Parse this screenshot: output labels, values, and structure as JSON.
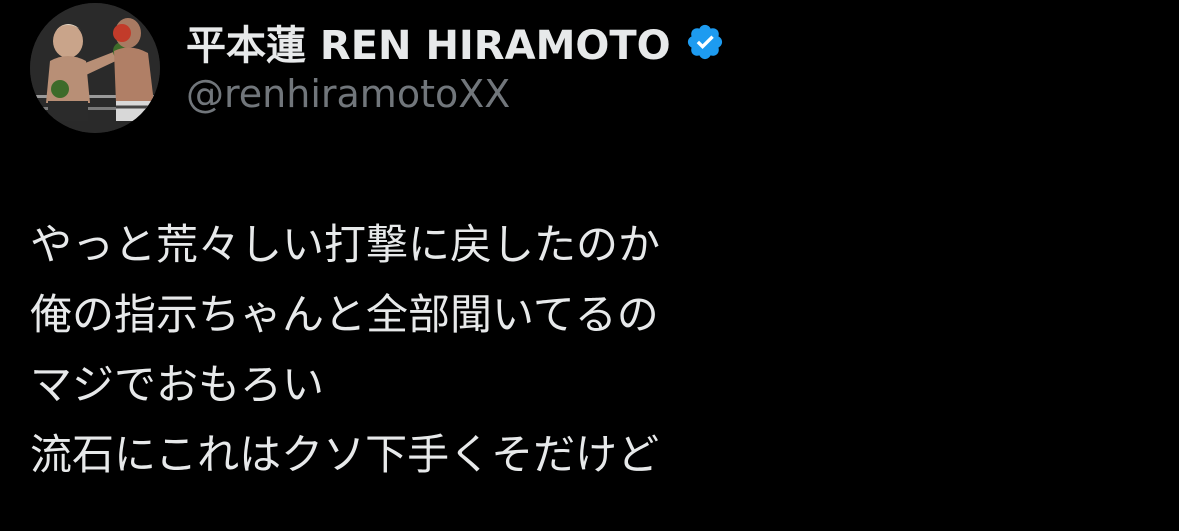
{
  "theme": {
    "background": "#000000",
    "text": "#e7e9ea",
    "muted": "#71767b",
    "verified_badge": "#1d9bf0"
  },
  "author": {
    "display_name": "平本蓮 REN HIRAMOTO",
    "handle": "@renhiramotoXX",
    "verified": true,
    "avatar_icon": "boxer-punch-photo"
  },
  "tweet": {
    "lines": [
      "やっと荒々しい打撃に戻したのか",
      "俺の指示ちゃんと全部聞いてるの",
      "マジでおもろい",
      "流石にこれはクソ下手くそだけど"
    ]
  }
}
